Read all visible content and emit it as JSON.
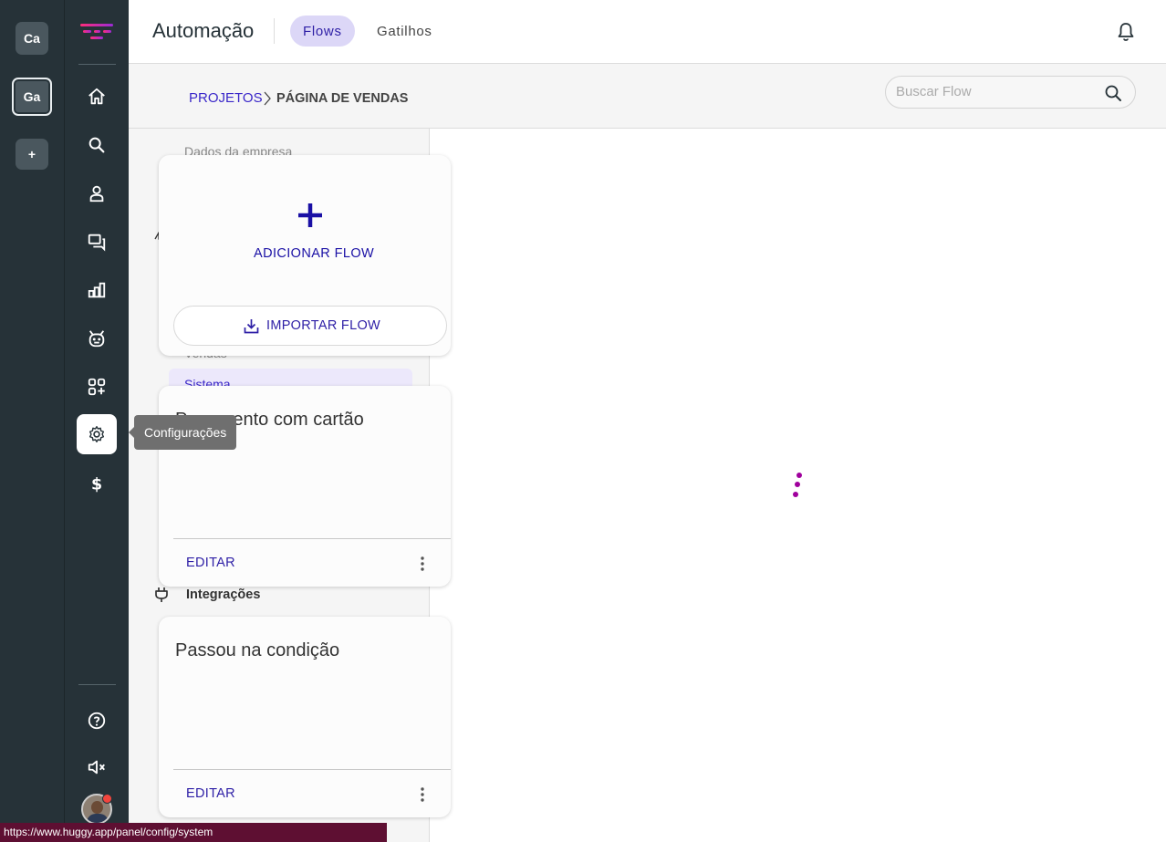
{
  "workspaces": [
    {
      "label": "Ca"
    },
    {
      "label": "Ga"
    },
    {
      "label": "+"
    }
  ],
  "nav": {
    "items": [
      {
        "icon": "home-icon"
      },
      {
        "icon": "search-icon"
      },
      {
        "icon": "contact-icon"
      },
      {
        "icon": "chat-icon"
      },
      {
        "icon": "reports-icon"
      },
      {
        "icon": "bot-icon"
      },
      {
        "icon": "apps-icon"
      },
      {
        "icon": "settings-icon"
      },
      {
        "icon": "billing-icon"
      },
      {
        "icon": "help-icon"
      },
      {
        "icon": "mute-icon"
      }
    ],
    "tooltip": "Configurações"
  },
  "header": {
    "title": "Automação",
    "tabs": [
      {
        "label": "Flows",
        "active": true
      },
      {
        "label": "Gatilhos",
        "active": false
      }
    ]
  },
  "breadcrumb": {
    "parent": "PROJETOS",
    "current": "PÁGINA DE VENDAS"
  },
  "search": {
    "placeholder": "Buscar Flow",
    "value": ""
  },
  "left_panel": {
    "faded_items": [
      "Dados da empresa",
      "Vendas"
    ],
    "selected_item": "Sistema",
    "integrations_label": "Integrações"
  },
  "add_card": {
    "add_label": "ADICIONAR FLOW",
    "import_label": "IMPORTAR FLOW"
  },
  "flows": [
    {
      "title": "Pagamento com cartão",
      "edit_label": "EDITAR"
    },
    {
      "title": "Passou na condição",
      "edit_label": "EDITAR"
    }
  ],
  "status_bar": {
    "url": "https://www.huggy.app/panel/config/system"
  },
  "colors": {
    "sidebar": "#263238",
    "accent": "#2e1fa6",
    "tab_active_bg": "#dcd7f7",
    "loader": "#a0009d",
    "status_bar": "#5e0f32"
  }
}
